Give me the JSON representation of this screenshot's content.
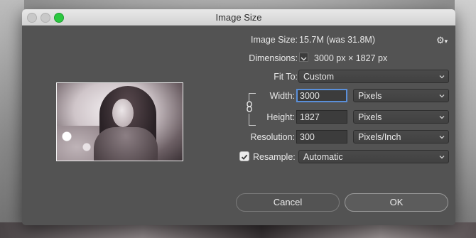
{
  "window": {
    "title": "Image Size"
  },
  "info": {
    "image_size_label": "Image Size:",
    "image_size_value": "15.7M (was 31.8M)",
    "dimensions_label": "Dimensions:",
    "dimensions_value": "3000 px  ×  1827 px"
  },
  "fit_to": {
    "label": "Fit To:",
    "value": "Custom"
  },
  "width": {
    "label": "Width:",
    "value": "3000",
    "unit": "Pixels"
  },
  "height": {
    "label": "Height:",
    "value": "1827",
    "unit": "Pixels"
  },
  "resolution": {
    "label": "Resolution:",
    "value": "300",
    "unit": "Pixels/Inch"
  },
  "resample": {
    "label": "Resample:",
    "value": "Automatic",
    "checked": true
  },
  "buttons": {
    "cancel": "Cancel",
    "ok": "OK"
  },
  "icons": {
    "settings": "gear-icon",
    "link": "chain-link-icon",
    "dropdown": "chevron-down-icon"
  },
  "colors": {
    "dialog_bg": "#535353",
    "focus": "#5a8fd9",
    "zoom_light": "#2bc840"
  }
}
